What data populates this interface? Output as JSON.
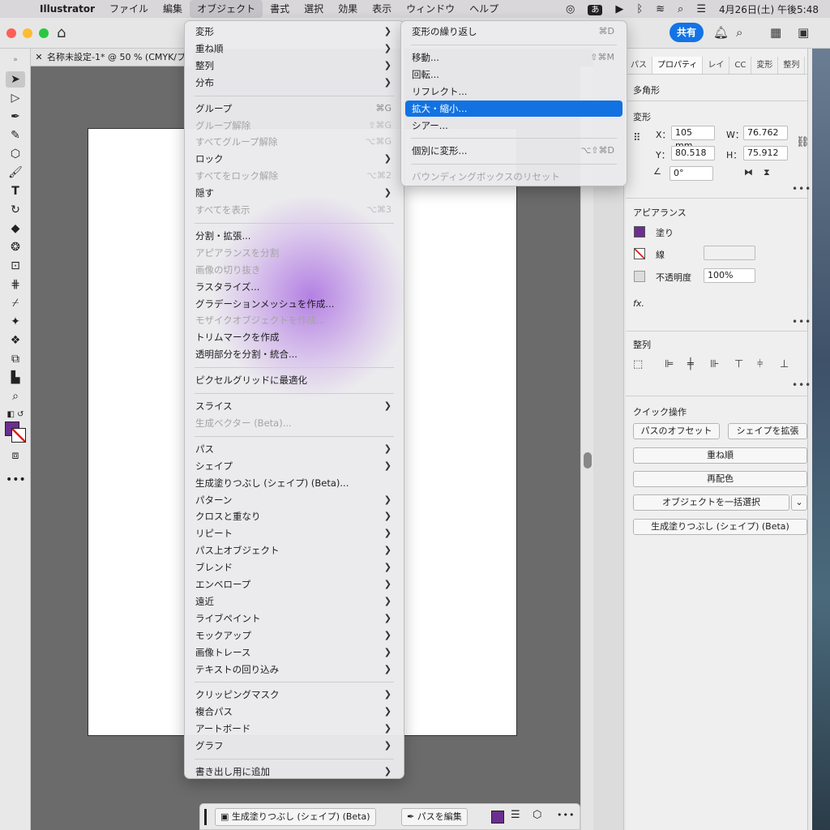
{
  "menubar": {
    "app": "Illustrator",
    "items": [
      "ファイル",
      "編集",
      "オブジェクト",
      "書式",
      "選択",
      "効果",
      "表示",
      "ウィンドウ",
      "ヘルプ"
    ],
    "active_index": 2,
    "ime": "あ",
    "clock": "4月26日(土) 午後5:48"
  },
  "appbar": {
    "share": "共有"
  },
  "doc_tab": {
    "title": "名称未設定-1* @ 50 % (CMYK/プ"
  },
  "panel": {
    "tabs": [
      "パス",
      "プロパティ",
      "レイ",
      "CC",
      "変形",
      "整列"
    ],
    "active_tab": 1,
    "object_type": "多角形",
    "transform": {
      "title": "変形",
      "x_label": "X：",
      "x": "105 mm",
      "y_label": "Y：",
      "y": "80.518",
      "w_label": "W：",
      "w": "76.762",
      "h_label": "H：",
      "h": "75.912",
      "angle": "0°"
    },
    "appearance": {
      "title": "アピアランス",
      "fill": "塗り",
      "stroke": "線",
      "opacity_label": "不透明度",
      "opacity": "100%",
      "fx": "fx."
    },
    "align": {
      "title": "整列"
    },
    "quick": {
      "title": "クイック操作",
      "offset": "パスのオフセット",
      "expand": "シェイプを拡張",
      "arrange": "重ね順",
      "recolor": "再配色",
      "select_all": "オブジェクトを一括選択",
      "gen_fill": "生成塗りつぶし (シェイプ) (Beta)"
    }
  },
  "object_menu": [
    {
      "label": "変形",
      "sub": true
    },
    {
      "label": "重ね順",
      "sub": true
    },
    {
      "label": "整列",
      "sub": true
    },
    {
      "label": "分布",
      "sub": true
    },
    {
      "sep": true
    },
    {
      "label": "グループ",
      "sc": "⌘G"
    },
    {
      "label": "グループ解除",
      "sc": "⇧⌘G",
      "disabled": true
    },
    {
      "label": "すべてグループ解除",
      "sc": "⌥⌘G",
      "disabled": true
    },
    {
      "label": "ロック",
      "sub": true
    },
    {
      "label": "すべてをロック解除",
      "sc": "⌥⌘2",
      "disabled": true
    },
    {
      "label": "隠す",
      "sub": true
    },
    {
      "label": "すべてを表示",
      "sc": "⌥⌘3",
      "disabled": true
    },
    {
      "sep": true
    },
    {
      "label": "分割・拡張..."
    },
    {
      "label": "アピアランスを分割",
      "disabled": true
    },
    {
      "label": "画像の切り抜き",
      "disabled": true
    },
    {
      "label": "ラスタライズ..."
    },
    {
      "label": "グラデーションメッシュを作成..."
    },
    {
      "label": "モザイクオブジェクトを作成...",
      "disabled": true
    },
    {
      "label": "トリムマークを作成"
    },
    {
      "label": "透明部分を分割・統合..."
    },
    {
      "sep": true
    },
    {
      "label": "ピクセルグリッドに最適化"
    },
    {
      "sep": true
    },
    {
      "label": "スライス",
      "sub": true
    },
    {
      "label": "生成ベクター (Beta)...",
      "disabled": true
    },
    {
      "sep": true
    },
    {
      "label": "パス",
      "sub": true
    },
    {
      "label": "シェイプ",
      "sub": true
    },
    {
      "label": "生成塗りつぶし (シェイプ) (Beta)..."
    },
    {
      "label": "パターン",
      "sub": true
    },
    {
      "label": "クロスと重なり",
      "sub": true
    },
    {
      "label": "リピート",
      "sub": true
    },
    {
      "label": "パス上オブジェクト",
      "sub": true
    },
    {
      "label": "ブレンド",
      "sub": true
    },
    {
      "label": "エンベロープ",
      "sub": true
    },
    {
      "label": "遠近",
      "sub": true
    },
    {
      "label": "ライブペイント",
      "sub": true
    },
    {
      "label": "モックアップ",
      "sub": true
    },
    {
      "label": "画像トレース",
      "sub": true
    },
    {
      "label": "テキストの回り込み",
      "sub": true
    },
    {
      "sep": true
    },
    {
      "label": "クリッピングマスク",
      "sub": true
    },
    {
      "label": "複合パス",
      "sub": true
    },
    {
      "label": "アートボード",
      "sub": true
    },
    {
      "label": "グラフ",
      "sub": true
    },
    {
      "sep": true
    },
    {
      "label": "書き出し用に追加",
      "sub": true
    }
  ],
  "transform_menu": [
    {
      "label": "変形の繰り返し",
      "sc": "⌘D"
    },
    {
      "sep": true
    },
    {
      "label": "移動...",
      "sc": "⇧⌘M"
    },
    {
      "label": "回転..."
    },
    {
      "label": "リフレクト..."
    },
    {
      "label": "拡大・縮小...",
      "hl": true
    },
    {
      "label": "シアー..."
    },
    {
      "sep": true
    },
    {
      "label": "個別に変形...",
      "sc": "⌥⇧⌘D"
    },
    {
      "sep": true
    },
    {
      "label": "バウンディングボックスのリセット",
      "disabled": true
    }
  ],
  "bottom_bar": {
    "gen_fill": "生成塗りつぶし (シェイプ) (Beta)",
    "edit_path": "パスを編集"
  },
  "colors": {
    "fill": "#6b2f8f",
    "accent": "#1272e2"
  },
  "icons": [
    "apple-icon",
    "home-icon",
    "bell-icon",
    "search-icon",
    "arrange-icon",
    "panel-icon",
    "selection-tool-icon",
    "direct-selection-icon",
    "pen-icon",
    "curvature-icon",
    "ellipse-icon",
    "paintbrush-icon",
    "type-icon",
    "rotate-icon",
    "eraser-icon",
    "warp-icon",
    "free-transform-icon",
    "eyedropper-icon",
    "artboard-icon",
    "zoom-icon",
    "link-icon"
  ]
}
